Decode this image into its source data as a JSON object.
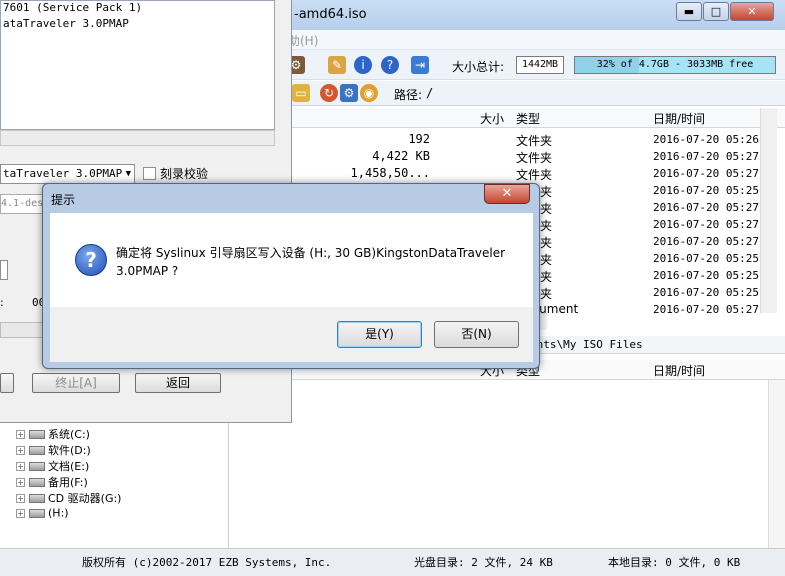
{
  "main_window": {
    "title": "-amd64.iso",
    "menu_help": "助(H)",
    "window_buttons": {
      "minimize": "▬",
      "maximize": "□",
      "close": "✕"
    },
    "toolbar": {
      "total_size_label": "大小总计:",
      "total_size_value": "1442MB",
      "capacity_text": "32% of 4.7GB - 3033MB free",
      "capacity_fraction": 0.32,
      "path_label": "路径:",
      "path_value": "/"
    },
    "list_headers": {
      "size": "大小",
      "type": "类型",
      "date": "日期/时间"
    },
    "rows": [
      {
        "size": "192",
        "type": "文件夹",
        "date": "2016-07-20 05:26"
      },
      {
        "size": "4,422 KB",
        "type": "文件夹",
        "date": "2016-07-20 05:27"
      },
      {
        "size": "1,458,50...",
        "type": "文件夹",
        "date": "2016-07-20 05:27"
      },
      {
        "size": "",
        "type": "文件夹",
        "date": "2016-07-20 05:25"
      },
      {
        "size": "",
        "type": "文件夹",
        "date": "2016-07-20 05:27"
      },
      {
        "size": "",
        "type": "文件夹",
        "date": "2016-07-20 05:27"
      },
      {
        "size": "",
        "type": "文件夹",
        "date": "2016-07-20 05:27"
      },
      {
        "size": "",
        "type": "文件夹",
        "date": "2016-07-20 05:25"
      },
      {
        "size": "",
        "type": "文件夹",
        "date": "2016-07-20 05:25"
      },
      {
        "size": "",
        "type": "文件夹",
        "date": "2016-07-20 05:25"
      },
      {
        "size": "",
        "type": "Document",
        "date": "2016-07-20 05:27"
      }
    ],
    "lower_path": "ents\\My ISO Files",
    "lower_headers": {
      "size": "大小",
      "type": "类型",
      "date": "日期/时间"
    },
    "status": {
      "copyright": "版权所有 (c)2002-2017 EZB Systems, Inc.",
      "cd_dir": "光盘目录: 2 文件, 24 KB",
      "local_dir": "本地目录: 0 文件, 0 KB"
    }
  },
  "left_dialog": {
    "device_lines": [
      "7601 (Service Pack 1)",
      "ataTraveler 3.0PMAP"
    ],
    "drive_select": "taTraveler 3.0PMAP",
    "verify_label": "刻录校验",
    "image_field": "4.1-des",
    "colon_label": ":",
    "oo_label": "00",
    "abort_button": "终止[A]",
    "back_button": "返回"
  },
  "drive_tree": [
    {
      "label": "系统(C:)"
    },
    {
      "label": "软件(D:)"
    },
    {
      "label": "文档(E:)"
    },
    {
      "label": "备用(F:)"
    },
    {
      "label": "CD 驱动器(G:)"
    },
    {
      "label": "(H:)"
    }
  ],
  "modal": {
    "title": "提示",
    "message": "确定将 Syslinux 引导扇区写入设备 (H:, 30 GB)KingstonDataTraveler 3.0PMAP ?",
    "yes_button": "是(Y)",
    "no_button": "否(N)",
    "close_glyph": "✕"
  }
}
